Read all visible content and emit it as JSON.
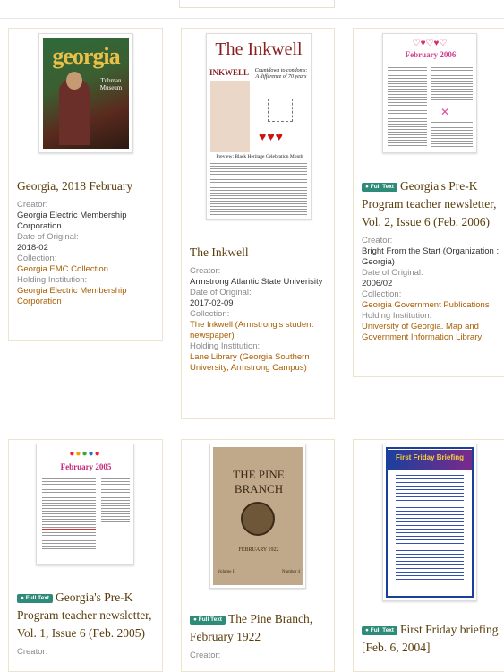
{
  "cards": [
    {
      "title": "Georgia, 2018 February",
      "full_text": false,
      "fields": [
        {
          "label": "Creator:",
          "value": "Georgia Electric Membership Corporation",
          "link": false
        },
        {
          "label": "Date of Original:",
          "value": "2018-02",
          "link": false
        },
        {
          "label": "Collection:",
          "value": "Georgia EMC Collection",
          "link": true
        },
        {
          "label": "Holding Institution:",
          "value": "Georgia Electric Membership Corporation",
          "link": true
        }
      ],
      "thumb_text": {
        "masthead": "georgia",
        "side": "Tubman Museum"
      }
    },
    {
      "title": "The Inkwell",
      "full_text": false,
      "fields": [
        {
          "label": "Creator:",
          "value": "Armstrong Atlantic State Univerisity",
          "link": false
        },
        {
          "label": "Date of Original:",
          "value": "2017-02-09",
          "link": false
        },
        {
          "label": "Collection:",
          "value": "The Inkwell (Armstrong's student newspaper)",
          "link": true
        },
        {
          "label": "Holding Institution:",
          "value": "Lane Library (Georgia Southern University, Armstrong Campus)",
          "link": true
        }
      ],
      "thumb_text": {
        "masthead": "The Inkwell",
        "side": "INKWELL",
        "headline": "Countdown to condoms: A difference of 70 years",
        "footer": "Preview: Black Heritage Celebration Month"
      }
    },
    {
      "title": "Georgia's Pre-K Program teacher newsletter, Vol. 2, Issue 6 (Feb. 2006)",
      "full_text": true,
      "fields": [
        {
          "label": "Creator:",
          "value": "Bright From the Start (Organization : Georgia)",
          "link": false
        },
        {
          "label": "Date of Original:",
          "value": "2006/02",
          "link": false
        },
        {
          "label": "Collection:",
          "value": "Georgia Government Publications",
          "link": true
        },
        {
          "label": "Holding Institution:",
          "value": "University of Georgia. Map and Government Information Library",
          "link": true
        }
      ],
      "thumb_text": {
        "masthead": "February 2006"
      }
    },
    {
      "title": "Georgia's Pre-K Program teacher newsletter, Vol. 1, Issue 6 (Feb. 2005)",
      "full_text": true,
      "fields": [
        {
          "label": "Creator:",
          "value": "",
          "link": false
        }
      ],
      "thumb_text": {
        "masthead": "February 2005"
      }
    },
    {
      "title": "The Pine Branch, February 1922",
      "full_text": true,
      "fields": [
        {
          "label": "Creator:",
          "value": "",
          "link": false
        }
      ],
      "thumb_text": {
        "masthead": "THE PINE BRANCH",
        "date": "FEBRUARY 1922",
        "vol": "Volume II",
        "num": "Number 4"
      }
    },
    {
      "title": "First Friday briefing [Feb. 6, 2004]",
      "full_text": true,
      "fields": [],
      "thumb_text": {
        "masthead": "First Friday Briefing"
      }
    }
  ],
  "badge_label": "Full Text",
  "colors": {
    "link": "#a85d00",
    "title": "#5a3d0c",
    "badge": "#2d8b78",
    "card_border": "#ede4ce"
  }
}
